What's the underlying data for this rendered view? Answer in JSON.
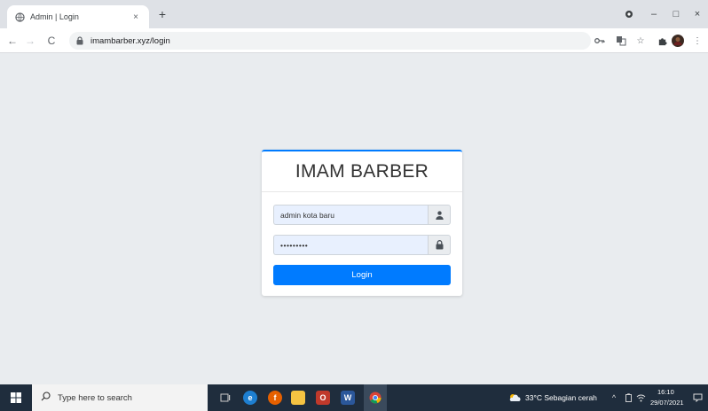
{
  "browser": {
    "tab": {
      "title": "Admin | Login",
      "close": "×"
    },
    "new_tab": "+",
    "window_controls": {
      "minimize": "–",
      "maximize": "□",
      "close": "×"
    },
    "nav": {
      "back": "←",
      "forward": "→",
      "reload": "C"
    },
    "url": "imambarber.xyz/login"
  },
  "login": {
    "brand": "IMAM BARBER",
    "username": {
      "value": "admin kota baru",
      "icon": "user-icon"
    },
    "password": {
      "value": "•••••••••",
      "icon": "lock-icon"
    },
    "button_label": "Login",
    "accent": "#007bff"
  },
  "taskbar": {
    "search_placeholder": "Type here to search",
    "weather": "33°C  Sebagian cerah",
    "time": "16:10",
    "date": "29/07/2021"
  }
}
